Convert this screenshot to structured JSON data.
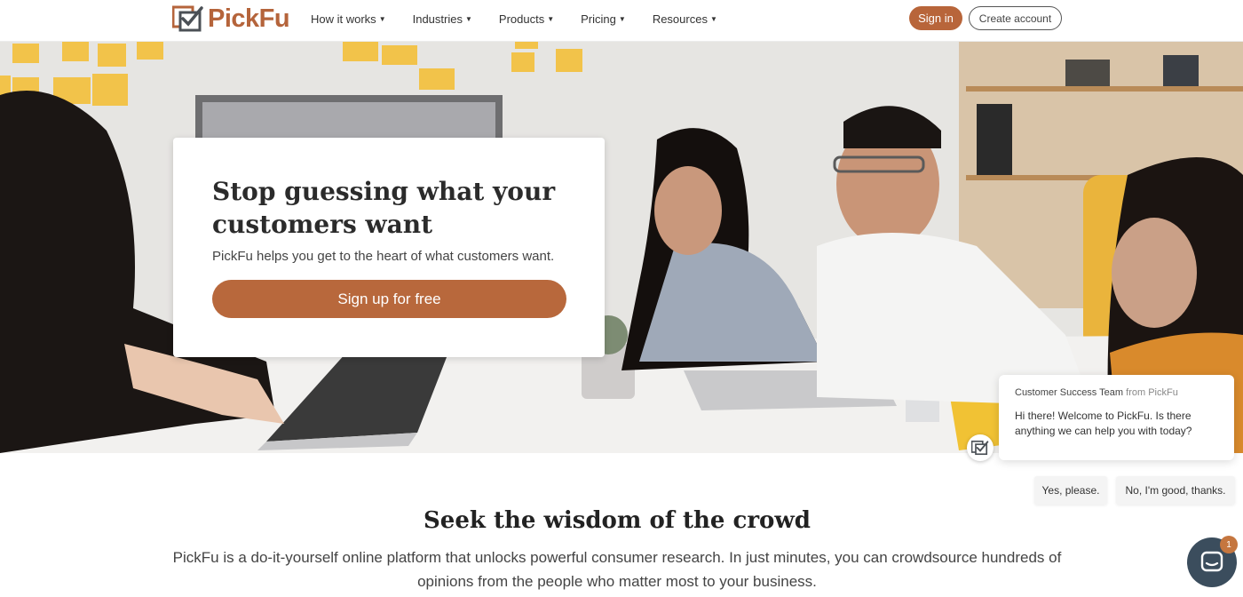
{
  "header": {
    "logo_text": "PickFu",
    "nav": [
      {
        "label": "How it works"
      },
      {
        "label": "Industries"
      },
      {
        "label": "Products"
      },
      {
        "label": "Pricing"
      },
      {
        "label": "Resources"
      }
    ],
    "sign_in": "Sign in",
    "create_account": "Create account"
  },
  "hero": {
    "title": "Stop guessing what your customers want",
    "subtitle": "PickFu helps you get to the heart of what customers want.",
    "cta": "Sign up for free"
  },
  "chat": {
    "team": "Customer Success Team",
    "from": "from PickFu",
    "message": "Hi there! Welcome to PickFu. Is there anything we can help you with today?",
    "reply_yes": "Yes, please.",
    "reply_no": "No, I'm good, thanks.",
    "badge_count": "1"
  },
  "section": {
    "title": "Seek the wisdom of the crowd",
    "body": "PickFu is a do-it-yourself online platform that unlocks powerful consumer research. In just minutes, you can crowdsource hundreds of opinions from the people who matter most to your business."
  },
  "colors": {
    "brand": "#b8653a",
    "launcher": "#3b4d5d"
  }
}
